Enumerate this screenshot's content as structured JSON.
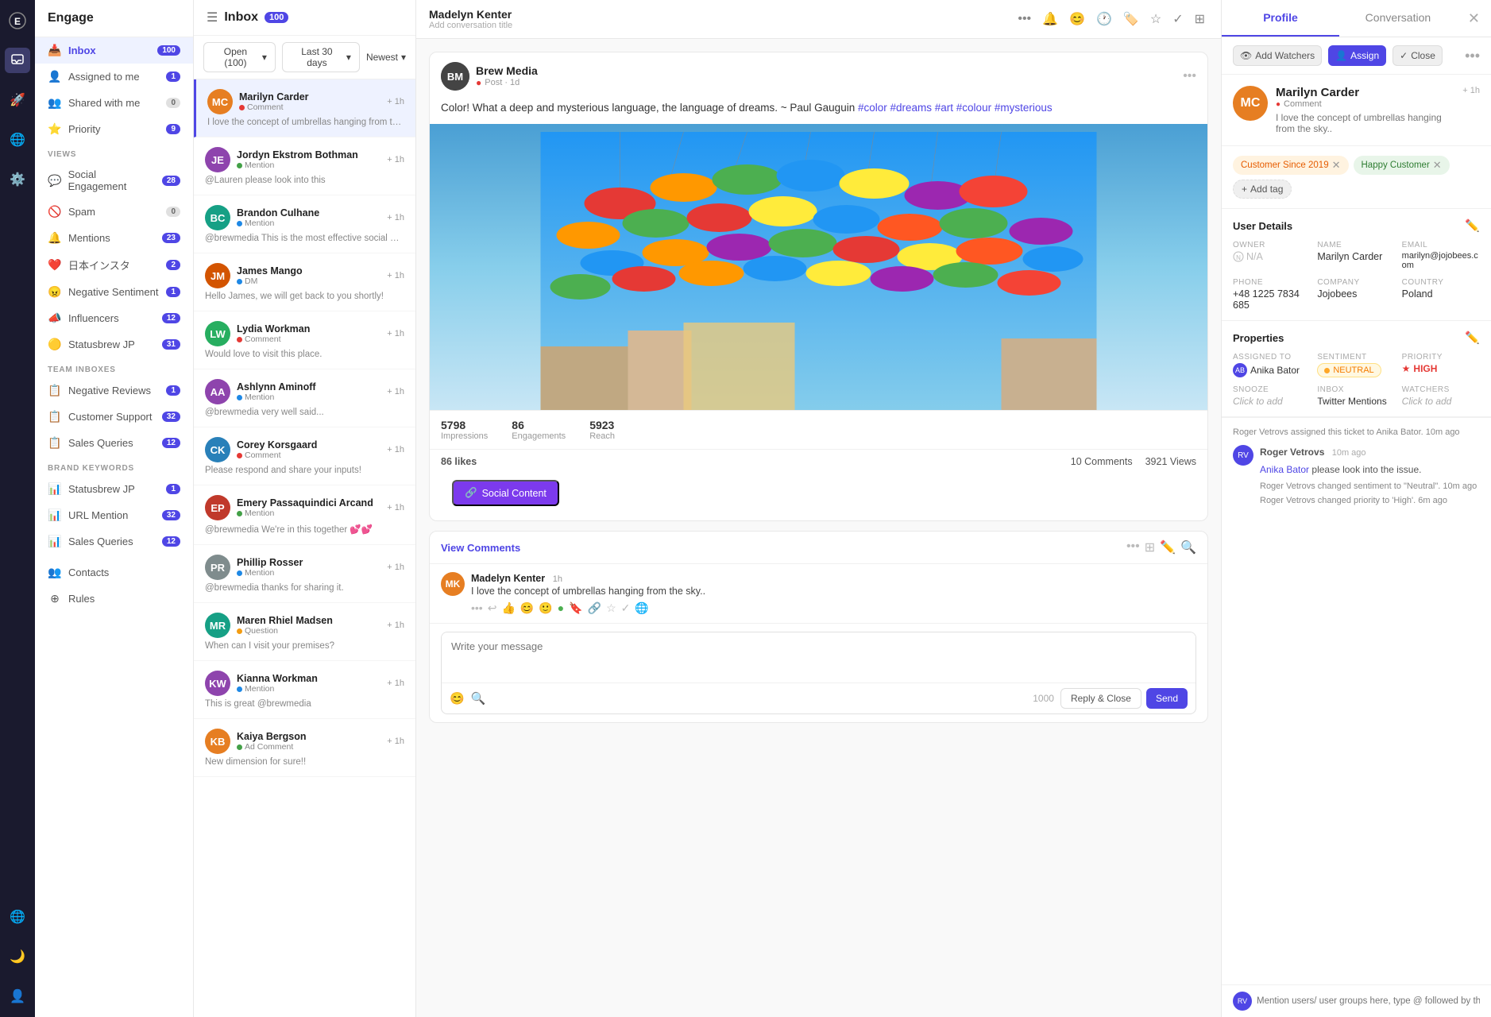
{
  "app": {
    "name": "Engage"
  },
  "iconBar": {
    "icons": [
      "✦",
      "🚀",
      "💬",
      "🌐",
      "⚙️",
      "👤"
    ]
  },
  "sidebar": {
    "header": "Engage",
    "mainItems": [
      {
        "id": "inbox",
        "label": "Inbox",
        "badge": "100",
        "badgeType": "purple",
        "icon": "📥"
      },
      {
        "id": "assigned",
        "label": "Assigned to me",
        "badge": "1",
        "badgeType": "purple",
        "icon": "👤"
      },
      {
        "id": "shared",
        "label": "Shared with me",
        "badge": "0",
        "badgeType": "gray",
        "icon": "👥"
      },
      {
        "id": "priority",
        "label": "Priority",
        "badge": "9",
        "badgeType": "purple",
        "icon": "⭐"
      }
    ],
    "viewsLabel": "VIEWS",
    "views": [
      {
        "id": "social",
        "label": "Social Engagement",
        "badge": "28",
        "icon": "💬"
      },
      {
        "id": "spam",
        "label": "Spam",
        "badge": "0",
        "icon": "🚫"
      },
      {
        "id": "mentions",
        "label": "Mentions",
        "badge": "23",
        "icon": "🔔"
      },
      {
        "id": "japanese",
        "label": "日本インスタ",
        "badge": "2",
        "icon": "❤️"
      },
      {
        "id": "negative",
        "label": "Negative Sentiment",
        "badge": "1",
        "icon": "😠"
      },
      {
        "id": "influencers",
        "label": "Influencers",
        "badge": "12",
        "icon": "📣"
      },
      {
        "id": "statusbrew",
        "label": "Statusbrew JP",
        "badge": "31",
        "icon": "🟡"
      }
    ],
    "teamInboxesLabel": "TEAM INBOXES",
    "teamInboxes": [
      {
        "id": "neg-reviews",
        "label": "Negative Reviews",
        "badge": "1",
        "icon": "📋"
      },
      {
        "id": "customer-support",
        "label": "Customer Support",
        "badge": "32",
        "icon": "📋"
      },
      {
        "id": "sales-queries",
        "label": "Sales Queries",
        "badge": "12",
        "icon": "📋"
      }
    ],
    "brandKeywordsLabel": "BRAND KEYWORDS",
    "brandKeywords": [
      {
        "id": "statusbrew-jp",
        "label": "Statusbrew JP",
        "badge": "1",
        "icon": "📊"
      },
      {
        "id": "url-mention",
        "label": "URL Mention",
        "badge": "32",
        "icon": "📊"
      },
      {
        "id": "sales-q2",
        "label": "Sales Queries",
        "badge": "12",
        "icon": "📊"
      }
    ],
    "bottomItems": [
      {
        "id": "contacts",
        "label": "Contacts",
        "icon": "👥"
      },
      {
        "id": "rules",
        "label": "Rules",
        "icon": "⊕"
      }
    ],
    "footerIcons": [
      "🌐",
      "🌙",
      "👤"
    ]
  },
  "inboxList": {
    "title": "Inbox",
    "filterLabel": "Open (100)",
    "dateFilter": "Last 30 days",
    "sortLabel": "Newest",
    "items": [
      {
        "id": 1,
        "name": "Marilyn Carder",
        "tagType": "Comment",
        "tagColor": "#e53935",
        "time": "+ 1h",
        "preview": "I love the concept of umbrellas hanging from the sky...",
        "active": true,
        "avatarColor": "#e67e22",
        "initials": "MC"
      },
      {
        "id": 2,
        "name": "Jordyn Ekstrom Bothman",
        "tagType": "Mention",
        "tagColor": "#43a047",
        "time": "+ 1h",
        "preview": "@Lauren please look into this",
        "active": false,
        "avatarColor": "#8e44ad",
        "initials": "JE"
      },
      {
        "id": 3,
        "name": "Brandon Culhane",
        "tagType": "Mention",
        "tagColor": "#1e88e5",
        "time": "+ 1h",
        "preview": "@brewmedia This is the most effective social media tips for...",
        "active": false,
        "avatarColor": "#16a085",
        "initials": "BC"
      },
      {
        "id": 4,
        "name": "James Mango",
        "tagType": "DM",
        "tagColor": "#1e88e5",
        "time": "+ 1h",
        "preview": "Hello James, we will get back to you shortly!",
        "active": false,
        "avatarColor": "#d35400",
        "initials": "JM"
      },
      {
        "id": 5,
        "name": "Lydia Workman",
        "tagType": "Comment",
        "tagColor": "#e53935",
        "time": "+ 1h",
        "preview": "Would love to visit this place.",
        "active": false,
        "avatarColor": "#27ae60",
        "initials": "LW"
      },
      {
        "id": 6,
        "name": "Ashlynn Aminoff",
        "tagType": "Mention",
        "tagColor": "#1e88e5",
        "time": "+ 1h",
        "preview": "@brewmedia very well said...",
        "active": false,
        "avatarColor": "#8e44ad",
        "initials": "AA"
      },
      {
        "id": 7,
        "name": "Corey Korsgaard",
        "tagType": "Comment",
        "tagColor": "#e53935",
        "time": "+ 1h",
        "preview": "Please respond and share your inputs!",
        "active": false,
        "avatarColor": "#2980b9",
        "initials": "CK"
      },
      {
        "id": 8,
        "name": "Emery Passaquindici Arcand",
        "tagType": "Mention",
        "tagColor": "#43a047",
        "time": "+ 1h",
        "preview": "@brewmedia We're in this together 💕💕",
        "active": false,
        "avatarColor": "#c0392b",
        "initials": "EP"
      },
      {
        "id": 9,
        "name": "Phillip Rosser",
        "tagType": "Mention",
        "tagColor": "#1e88e5",
        "time": "+ 1h",
        "preview": "@brewmedia thanks for sharing it.",
        "active": false,
        "avatarColor": "#7f8c8d",
        "initials": "PR"
      },
      {
        "id": 10,
        "name": "Maren Rhiel Madsen",
        "tagType": "Question",
        "tagColor": "#f39c12",
        "time": "+ 1h",
        "preview": "When can I visit your premises?",
        "active": false,
        "avatarColor": "#16a085",
        "initials": "MR"
      },
      {
        "id": 11,
        "name": "Kianna Workman",
        "tagType": "Mention",
        "tagColor": "#1e88e5",
        "time": "+ 1h",
        "preview": "This is great @brewmedia",
        "active": false,
        "avatarColor": "#8e44ad",
        "initials": "KW"
      },
      {
        "id": 12,
        "name": "Kaiya Bergson",
        "tagType": "Ad Comment",
        "tagColor": "#43a047",
        "time": "+ 1h",
        "preview": "New dimension for sure!!",
        "active": false,
        "avatarColor": "#e67e22",
        "initials": "KB"
      }
    ]
  },
  "conversation": {
    "header": {
      "name": "Madelyn Kenter",
      "placeholder": "Add conversation title"
    },
    "post": {
      "sourceName": "Brew Media",
      "sourceIcon": "BM",
      "postMeta": "Post · 1d",
      "text": "Color! What a deep and mysterious language, the language of dreams. ~ Paul Gauguin",
      "hashtags": "#color #dreams #art #colour #mysterious",
      "stats": [
        {
          "value": "5798",
          "label": "Impressions"
        },
        {
          "value": "86",
          "label": "Engagements"
        },
        {
          "value": "5923",
          "label": "Reach"
        }
      ],
      "likes": "86 likes",
      "comments": "10 Comments",
      "views": "3921 Views",
      "socialContentBtn": "Social Content"
    },
    "comment": {
      "viewCommentsLabel": "View Comments",
      "author": "Madelyn Kenter",
      "time": "1h",
      "text": "I love the concept of umbrellas hanging from the sky..",
      "avatarColor": "#e67e22",
      "initials": "MK"
    },
    "replyBox": {
      "placeholder": "Write your message",
      "charCount": "1000",
      "closeBtnLabel": "Reply & Close",
      "sendBtnLabel": "Send"
    }
  },
  "rightPanel": {
    "tabs": [
      {
        "id": "profile",
        "label": "Profile",
        "active": true
      },
      {
        "id": "conversation",
        "label": "Conversation",
        "active": false
      }
    ],
    "actions": {
      "addWatchers": "Add Watchers",
      "assign": "Assign",
      "close": "Close"
    },
    "profile": {
      "name": "Marilyn Carder",
      "tag": "Comment",
      "tagColor": "#e53935",
      "preview": "I love the concept of umbrellas hanging from the sky..",
      "time": "+ 1h",
      "avatarColor": "#e67e22",
      "initials": "MC"
    },
    "tags": [
      {
        "label": "Customer Since 2019",
        "type": "orange"
      },
      {
        "label": "Happy Customer",
        "type": "green"
      }
    ],
    "addTagLabel": "+ Add tag",
    "userDetails": {
      "title": "User Details",
      "fields": [
        {
          "label": "OWNER",
          "value": "N/A",
          "isNA": true,
          "span": 1
        },
        {
          "label": "NAME",
          "value": "Marilyn Carder",
          "span": 1
        },
        {
          "label": "EMAIL",
          "value": "marilyn@jojobees.com",
          "span": 1
        },
        {
          "label": "PHONE",
          "value": "+48 1225 7834 685",
          "span": 1
        },
        {
          "label": "COMPANY",
          "value": "Jojobees",
          "span": 1
        },
        {
          "label": "COUNTRY",
          "value": "Poland",
          "span": 1
        }
      ]
    },
    "properties": {
      "title": "Properties",
      "assignedTo": "Anika Bator",
      "assignedAvatarColor": "#4f46e5",
      "assignedInitials": "AB",
      "sentiment": "NEUTRAL",
      "sentimentColor": "#ffa726",
      "priority": "HIGH",
      "priorityColor": "#e53935",
      "snooze": "Click to add",
      "inbox": "Twitter Mentions",
      "watchers": "Click to add"
    },
    "activity": [
      {
        "text": "Roger Vetrovs assigned this ticket to Anika Bator. 10m ago",
        "avatarColor": "#4f46e5",
        "initials": "RV",
        "time": ""
      },
      {
        "authorLabel": "Roger Vetrovs",
        "time": "10m ago",
        "lines": [
          "Anika Bator please look into the issue.",
          "Roger Vetrovs changed sentiment to \"Neutral\". 10m ago",
          "Roger Vetrovs changed priority to 'High'. 6m ago"
        ],
        "avatarColor": "#4f46e5",
        "initials": "RV"
      }
    ],
    "bottomPlaceholder": "Mention users/ user groups here, type @ followed by their name"
  }
}
